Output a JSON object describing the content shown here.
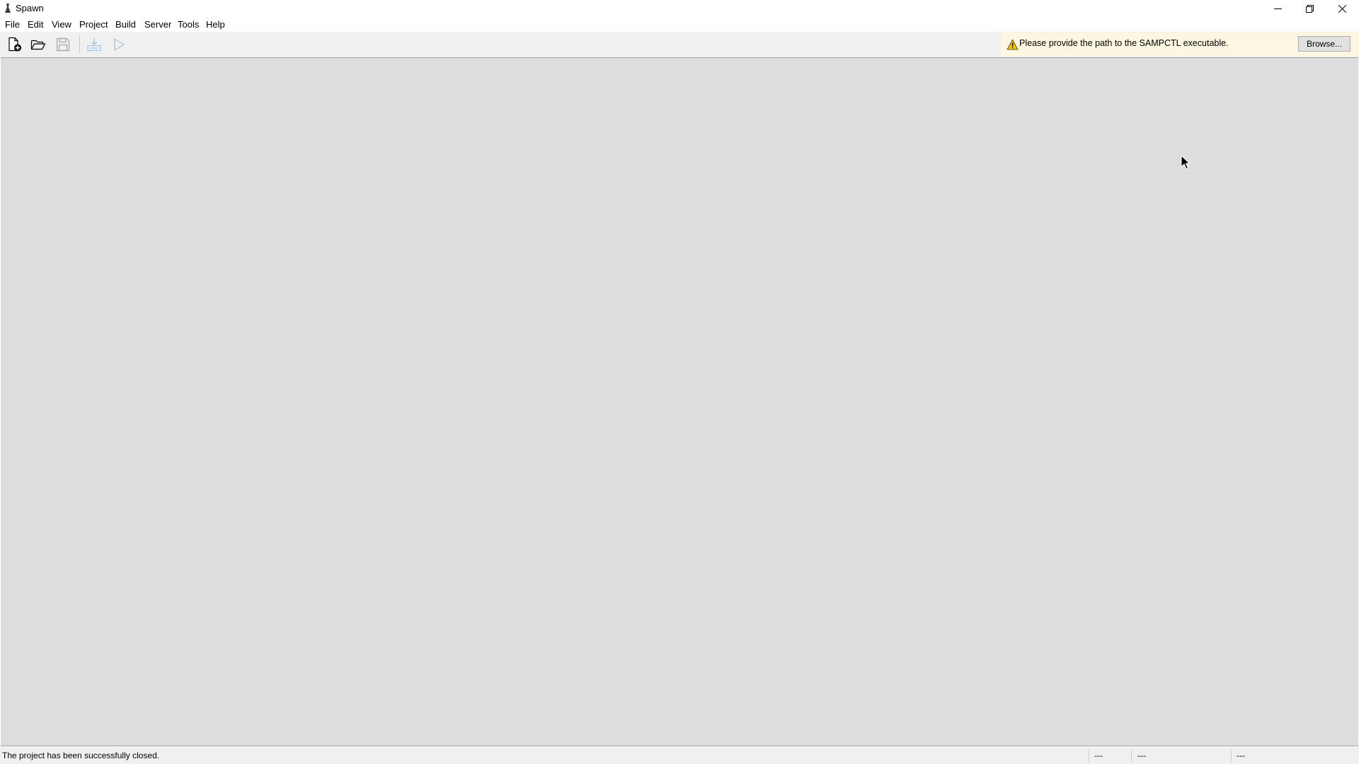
{
  "window": {
    "title": "Spawn",
    "controls": [
      "minimize-icon",
      "restore-icon",
      "close-icon"
    ]
  },
  "menu": {
    "items": [
      "File",
      "Edit",
      "View",
      "Project",
      "Build",
      "Server",
      "Tools",
      "Help"
    ]
  },
  "toolbar": {
    "buttons": [
      {
        "icon": "new-project-icon",
        "enabled": true
      },
      {
        "icon": "open-folder-icon",
        "enabled": true
      },
      {
        "icon": "save-icon",
        "enabled": false
      },
      {
        "icon": "build-icon",
        "enabled": false
      },
      {
        "icon": "run-icon",
        "enabled": false
      }
    ]
  },
  "notification": {
    "icon": "warning-icon",
    "message": "Please provide the path to the SAMPCTL executable.",
    "browse_label": "Browse...",
    "background": "#fdf7e1"
  },
  "status": {
    "message": "The project has been successfully closed.",
    "field1": "---",
    "field2": "---",
    "field3": "---"
  },
  "colors": {
    "workspace": "#dcdedd",
    "chrome": "#f0f0f0",
    "warning": "#f5c400"
  }
}
